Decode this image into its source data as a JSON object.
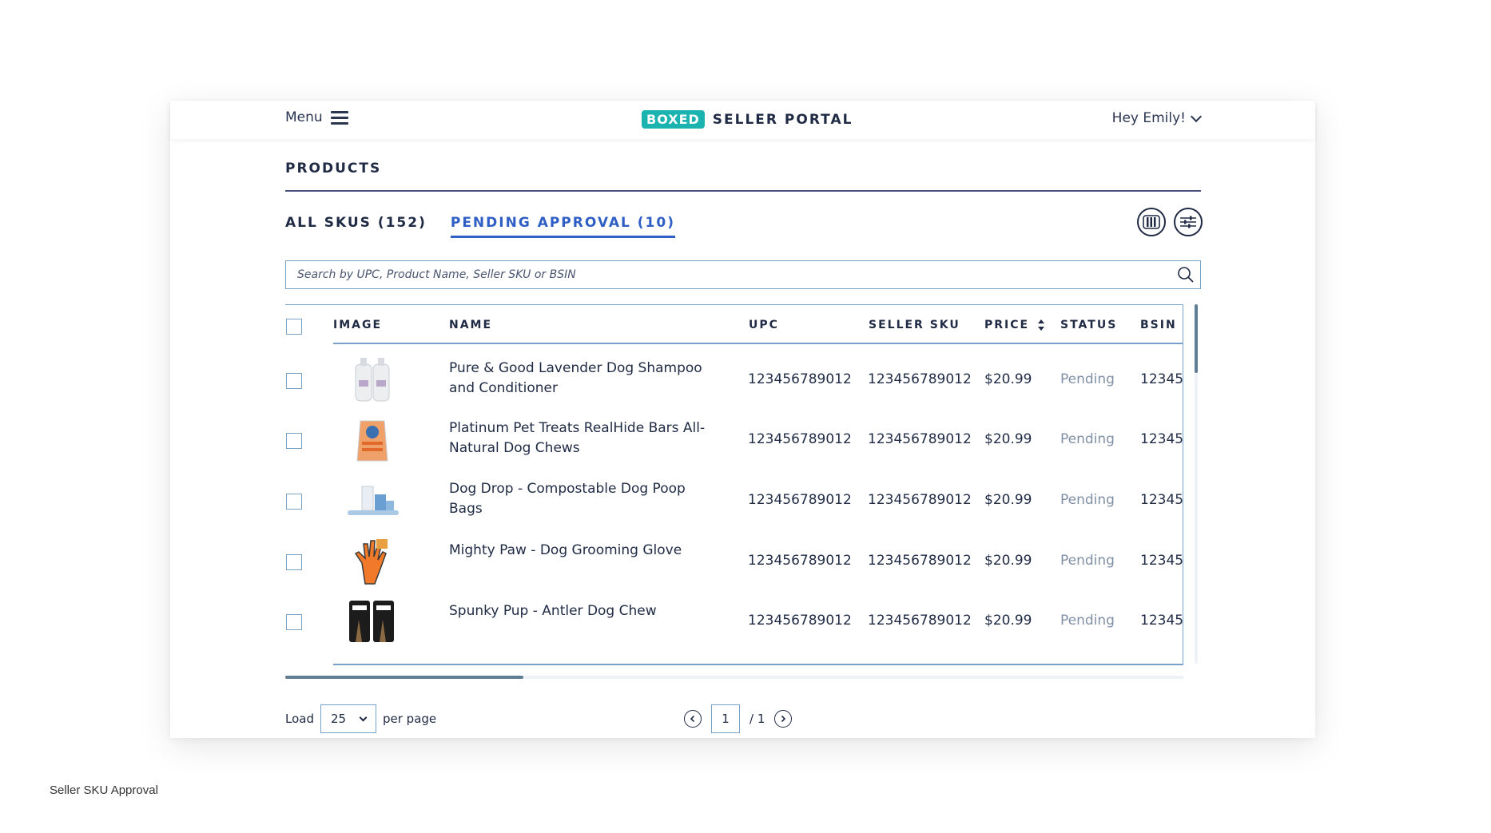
{
  "header": {
    "menu_label": "Menu",
    "brand_logo": "BOXED",
    "brand_title": "SELLER PORTAL",
    "user_greeting": "Hey Emily!"
  },
  "page": {
    "title": "PRODUCTS"
  },
  "tabs": [
    {
      "label": "ALL SKUS (152)",
      "active": false
    },
    {
      "label": "PENDING APPROVAL (10)",
      "active": true
    }
  ],
  "toolbar": {
    "columns_icon": "columns-icon",
    "filters_icon": "sliders-icon"
  },
  "search": {
    "placeholder": "Search by UPC, Product Name, Seller SKU or BSIN",
    "value": ""
  },
  "table": {
    "columns": [
      "IMAGE",
      "NAME",
      "UPC",
      "SELLER SKU",
      "PRICE",
      "STATUS",
      "BSIN"
    ],
    "rows": [
      {
        "name": "Pure & Good Lavender Dog Shampoo and Conditioner",
        "upc": "123456789012",
        "seller_sku": "123456789012",
        "price": "$20.99",
        "status": "Pending",
        "bsin": "12345",
        "image": "shampoo-bottles-image"
      },
      {
        "name": "Platinum Pet Treats RealHide Bars All-Natural Dog Chews",
        "upc": "123456789012",
        "seller_sku": "123456789012",
        "price": "$20.99",
        "status": "Pending",
        "bsin": "12345",
        "image": "treat-bag-image"
      },
      {
        "name": "Dog Drop - Compostable Dog Poop Bags",
        "upc": "123456789012",
        "seller_sku": "123456789012",
        "price": "$20.99",
        "status": "Pending",
        "bsin": "12345",
        "image": "poop-bags-image"
      },
      {
        "name": "Mighty Paw - Dog Grooming Glove",
        "upc": "123456789012",
        "seller_sku": "123456789012",
        "price": "$20.99",
        "status": "Pending",
        "bsin": "12345",
        "image": "grooming-glove-image"
      },
      {
        "name": "Spunky Pup - Antler Dog Chew",
        "upc": "123456789012",
        "seller_sku": "123456789012",
        "price": "$20.99",
        "status": "Pending",
        "bsin": "12345",
        "image": "antler-chew-image"
      }
    ]
  },
  "footer": {
    "load_label": "Load",
    "per_page_value": "25",
    "per_page_label": "per page",
    "current_page": "1",
    "total_pages_label": "/ 1"
  },
  "caption": "Seller SKU Approval",
  "colors": {
    "accent": "#2f5fc4",
    "brand": "#1bb3b0",
    "border": "#7aa1c7",
    "status": "#7f8fa6"
  }
}
